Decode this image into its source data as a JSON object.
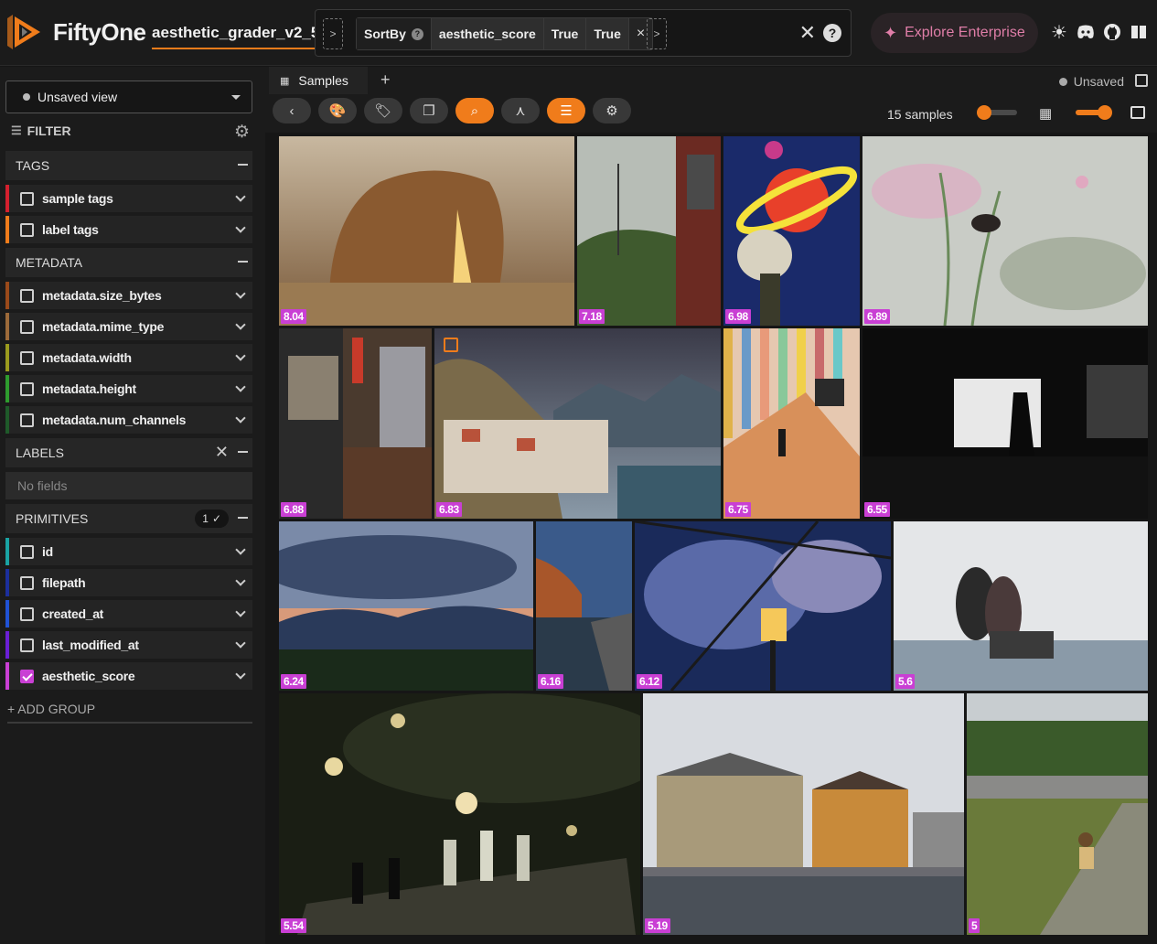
{
  "app": {
    "brand": "FiftyOne",
    "dataset": "aesthetic_grader_v2_5",
    "enterprise_label": "Explore Enterprise"
  },
  "viewbar": {
    "stage_name": "SortBy",
    "params": [
      "aesthetic_score",
      "True",
      "True"
    ],
    "close": "×"
  },
  "sidebar": {
    "view_select": "Unsaved view",
    "filter_title": "FILTER",
    "groups": {
      "tags": "TAGS",
      "metadata": "METADATA",
      "labels": "LABELS",
      "primitives": "PRIMITIVES"
    },
    "tag_fields": [
      "sample tags",
      "label tags"
    ],
    "metadata_fields": [
      "metadata.size_bytes",
      "metadata.mime_type",
      "metadata.width",
      "metadata.height",
      "metadata.num_channels"
    ],
    "no_fields": "No fields",
    "primitives_badge": "1",
    "primitive_fields": [
      "id",
      "filepath",
      "created_at",
      "last_modified_at",
      "aesthetic_score"
    ],
    "add_group": "+ ADD GROUP",
    "field_colors": {
      "sample_tags": "#d4202e",
      "label_tags": "#f07c1b",
      "size_bytes": "#9a4a1a",
      "mime_type": "#9c6a3a",
      "width": "#9b9b1e",
      "height": "#2e9c2e",
      "num_channels": "#1f5a2a",
      "id": "#1aa3a3",
      "filepath": "#1c2f9c",
      "created_at": "#2052d4",
      "last_modified_at": "#6a1fd4",
      "aesthetic_score": "#c93fd4"
    }
  },
  "tabs": {
    "samples": "Samples",
    "unsaved": "Unsaved"
  },
  "toolbar": {
    "samples_count": "15 samples"
  },
  "samples": [
    {
      "score": "8.04"
    },
    {
      "score": "7.18"
    },
    {
      "score": "6.98"
    },
    {
      "score": "6.89"
    },
    {
      "score": "6.88"
    },
    {
      "score": "6.83"
    },
    {
      "score": "6.75"
    },
    {
      "score": "6.55"
    },
    {
      "score": "6.24"
    },
    {
      "score": "6.16"
    },
    {
      "score": "6.12"
    },
    {
      "score": "5.6"
    },
    {
      "score": "5.54"
    },
    {
      "score": "5.19"
    },
    {
      "score": "5"
    }
  ],
  "colors": {
    "accent": "#f07c1b",
    "score_badge": "#c93fd4",
    "enterprise": "#e07ea8"
  }
}
